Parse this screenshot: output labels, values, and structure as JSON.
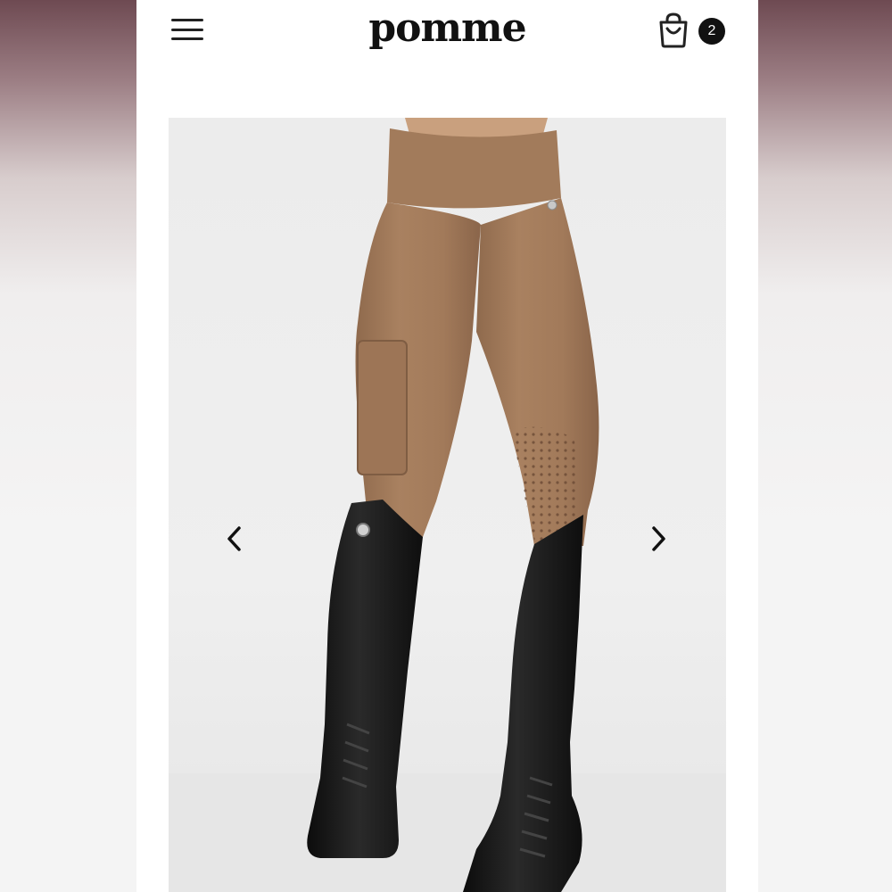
{
  "header": {
    "brand": "pomme",
    "menu_icon": "hamburger-menu-icon",
    "cart_icon": "shopping-bag-icon",
    "cart_count": "2"
  },
  "gallery": {
    "prev_icon": "chevron-left-icon",
    "next_icon": "chevron-right-icon"
  },
  "colors": {
    "page_bg": "#ffffff",
    "text": "#111111",
    "leggings": "#a47c5c",
    "boots": "#161616"
  }
}
